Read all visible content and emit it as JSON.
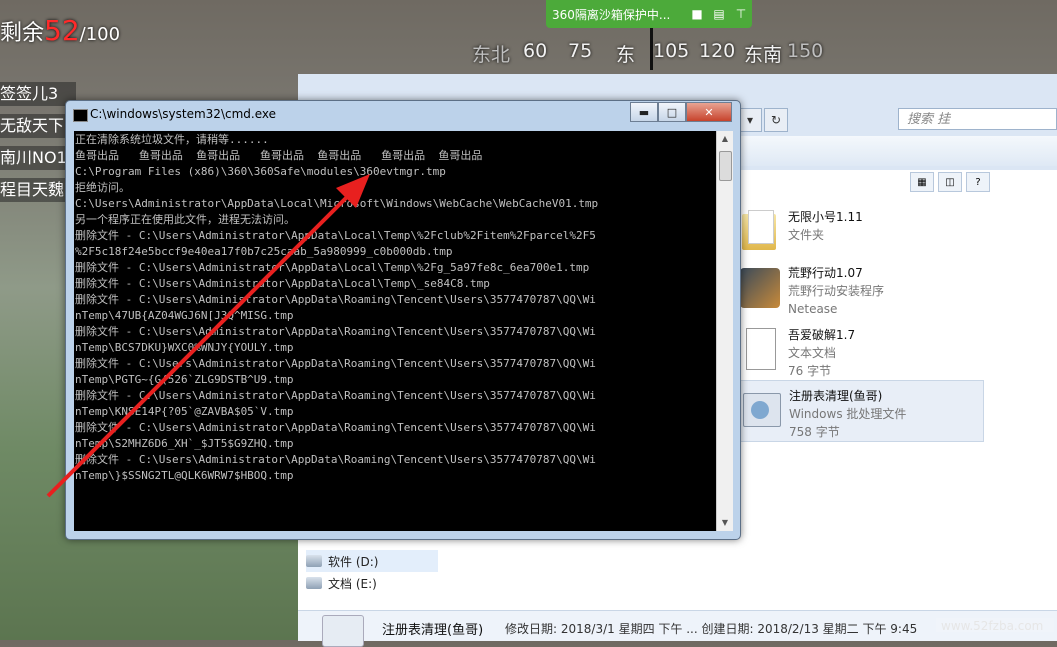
{
  "hud": {
    "remaining_label": "剩余",
    "remaining_count": "52",
    "remaining_total": "/100",
    "compass": [
      "东北",
      "60",
      "75",
      "东",
      "105",
      "120",
      "东南",
      "150"
    ],
    "killfeed": [
      "签签儿3",
      "无敌天下",
      "南川NO1",
      "程目天魏"
    ]
  },
  "sandbox_bar": {
    "label": "360隔离沙箱保护中...",
    "icons": [
      "shield-icon",
      "folder-icon",
      "pin-icon"
    ]
  },
  "explorer": {
    "search_placeholder": "搜索 挂",
    "nav": [
      {
        "label": "软件 (D:)"
      },
      {
        "label": "文档 (E:)"
      }
    ],
    "files": [
      {
        "name": "无限小号1.11",
        "subtitle": "文件夹",
        "extra": ""
      },
      {
        "name": "荒野行动1.07",
        "subtitle": "荒野行动安装程序",
        "extra": "Netease"
      },
      {
        "name": "吾爱破解1.7",
        "subtitle": "文本文档",
        "extra": "76 字节"
      },
      {
        "name": "注册表清理(鱼哥)",
        "subtitle": "Windows 批处理文件",
        "extra": "758 字节"
      }
    ],
    "details": {
      "name": "注册表清理(鱼哥)",
      "modified": "修改日期: 2018/3/1 星期四 下午 ...",
      "created": "创建日期: 2018/2/13 星期二 下午 9:45"
    }
  },
  "cmd": {
    "title": "C:\\windows\\system32\\cmd.exe",
    "lines": [
      "正在清除系统垃圾文件，请稍等......",
      "鱼哥出品   鱼哥出品  鱼哥出品   鱼哥出品  鱼哥出品   鱼哥出品  鱼哥出品",
      "C:\\Program Files (x86)\\360\\360Safe\\modules\\360evtmgr.tmp",
      "拒绝访问。",
      "C:\\Users\\Administrator\\AppData\\Local\\Microsoft\\Windows\\WebCache\\WebCacheV01.tmp",
      "另一个程序正在使用此文件，进程无法访问。",
      "删除文件 - C:\\Users\\Administrator\\AppData\\Local\\Temp\\%2Fclub%2Fitem%2Fparcel%2F5",
      "%2F5c18f24e5bccf9e40ea17f0b7c25caab_5a980999_c0b000db.tmp",
      "删除文件 - C:\\Users\\Administrator\\AppData\\Local\\Temp\\%2Fg_5a97fe8c_6ea700e1.tmp",
      "删除文件 - C:\\Users\\Administrator\\AppData\\Local\\Temp\\_se84C8.tmp",
      "删除文件 - C:\\Users\\Administrator\\AppData\\Roaming\\Tencent\\Users\\3577470787\\QQ\\Wi",
      "nTemp\\47UB{AZ04WGJ6N[J3Q^MISG.tmp",
      "删除文件 - C:\\Users\\Administrator\\AppData\\Roaming\\Tencent\\Users\\3577470787\\QQ\\Wi",
      "nTemp\\BCS7DKU}WXC0%WNJY{YOULY.tmp",
      "删除文件 - C:\\Users\\Administrator\\AppData\\Roaming\\Tencent\\Users\\3577470787\\QQ\\Wi",
      "nTemp\\PGTG~{G(526`ZLG9DSTB^U9.tmp",
      "删除文件 - C:\\Users\\Administrator\\AppData\\Roaming\\Tencent\\Users\\3577470787\\QQ\\Wi",
      "nTemp\\KNSE14P{?05`@ZAVBA$05`V.tmp",
      "删除文件 - C:\\Users\\Administrator\\AppData\\Roaming\\Tencent\\Users\\3577470787\\QQ\\Wi",
      "nTemp\\S2MHZ6D6_XH`_$JT5$G9ZHQ.tmp",
      "删除文件 - C:\\Users\\Administrator\\AppData\\Roaming\\Tencent\\Users\\3577470787\\QQ\\Wi",
      "nTemp\\}$SSNG2TL@QLK6WRW7$HBOQ.tmp"
    ]
  },
  "watermark": "www.52fzba.com",
  "colors": {
    "arrow": "#e8201f",
    "remaining": "#ff2a2a",
    "sandbox": "#4caa3a"
  }
}
